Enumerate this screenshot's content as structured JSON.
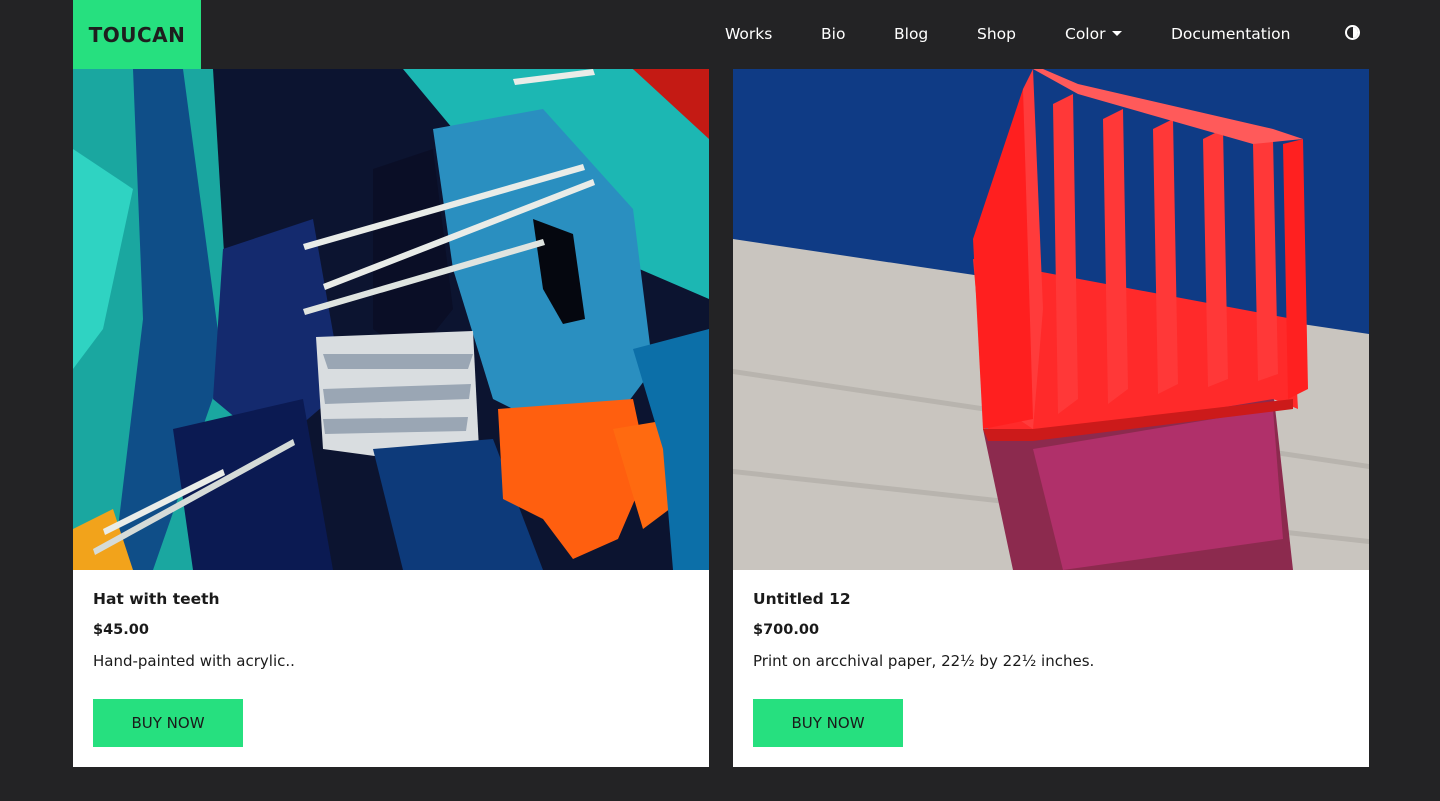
{
  "brand": {
    "name": "TOUCAN",
    "color": "#26e07f"
  },
  "nav": {
    "items": [
      {
        "label": "Works"
      },
      {
        "label": "Bio"
      },
      {
        "label": "Blog"
      },
      {
        "label": "Shop"
      },
      {
        "label": "Color",
        "dropdown": true
      },
      {
        "label": "Documentation"
      }
    ],
    "theme_toggle_icon": "half-circle-contrast-icon"
  },
  "products": [
    {
      "title": "Hat with teeth",
      "price": "$45.00",
      "description": "Hand-painted with acrylic..",
      "button_label": "BUY NOW"
    },
    {
      "title": "Untitled 12",
      "price": "$700.00",
      "description": "Print on arcchival paper, 22½ by 22½ inches.",
      "button_label": "BUY NOW"
    }
  ],
  "colors": {
    "background": "#232325",
    "accent": "#26e07f",
    "card": "#ffffff",
    "text": "#1a1a1a"
  }
}
